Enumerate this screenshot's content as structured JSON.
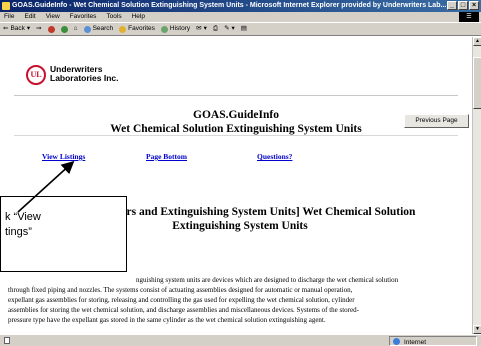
{
  "window": {
    "title": "GOAS.GuideInfo - Wet Chemical Solution Extinguishing System Units - Microsoft Internet Explorer provided by Underwriters Lab...",
    "minimize": "_",
    "maximize": "□",
    "close": "×"
  },
  "menu": [
    "File",
    "Edit",
    "View",
    "Favorites",
    "Tools",
    "Help"
  ],
  "toolbar": {
    "back": "Back",
    "search": "Search",
    "favorites": "Favorites",
    "history": "History"
  },
  "page": {
    "logo_mark": "UL",
    "company_line1": "Underwriters",
    "company_line2": "Laboratories Inc.",
    "title_line1": "GOAS.GuideInfo",
    "title_line2": "Wet Chemical Solution Extinguishing System Units",
    "links": {
      "view_listings": "View Listings",
      "page_bottom": "Page Bottom",
      "questions": "Questions?"
    },
    "previous_page": "Previous Page",
    "section_line1": "[Extinguishers and Extinguishing System Units] Wet Chemical Solution",
    "section_line2": "Extinguishing System Units",
    "body_line1_end": "nguishing system units are devices which are designed to discharge the wet chemical solution",
    "body_line2": "through fixed piping and nozzles. The systems consist of actuating assemblies designed for automatic or manual operation,",
    "body_line3": "expellant gas assemblies for storing, releasing and controlling the gas used for expelling the wet chemical solution, cylinder",
    "body_line4": "assemblies for storing the wet chemical solution, and discharge assemblies and miscellaneous devices. Systems of the stored-",
    "body_line5": "pressure type have the expellant gas stored in the same cylinder as the wet chemical solution extinguishing agent."
  },
  "callout": {
    "line1": "k “View",
    "line2": "tings”"
  },
  "status": {
    "zone": "Internet"
  }
}
